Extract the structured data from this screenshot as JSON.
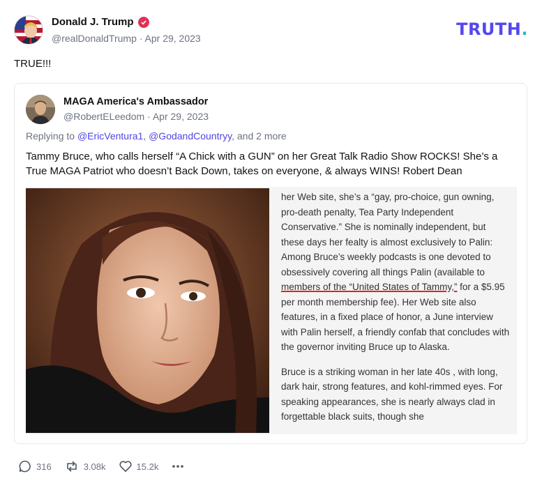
{
  "post": {
    "author_name": "Donald J. Trump",
    "handle": "@realDonaldTrump",
    "date": "Apr 29, 2023",
    "text": "TRUE!!!",
    "verified_icon": "verified-badge-icon",
    "avatar_icon": "avatar"
  },
  "brand": {
    "logo_text": "TRUTH",
    "logo_dot": ".",
    "accent": "#5448ee",
    "dot_color": "#12c6b4"
  },
  "quote": {
    "author_name": "MAGA America's Ambassador",
    "handle": "@RobertELeedom",
    "date": "Apr 29, 2023",
    "replying_prefix": "Replying to",
    "mention_1": "@EricVentura1",
    "mention_2": "@GodandCountryy",
    "replying_suffix": ", and 2 more",
    "mention_color": "#4f46e5",
    "body": "Tammy Bruce, who calls herself “A Chick with a GUN” on her Great Talk Radio Show ROCKS! She’s a True MAGA Patriot who doesn’t Back Down, takes on everyone, & always WINS! Robert Dean",
    "article": {
      "p1_a": "her Web site, she’s a “gay, pro-choice, gun owning, pro-death penalty, Tea Party Independent Conservative.” She is nominally independent, but these days her fealty is almost exclusively to Palin: Among Bruce’s weekly podcasts is one devoted to obsessively covering all things Palin (available to ",
      "p1_underlined": "members of the “United States of Tammy,”",
      "p1_b": " for a $5.95 per month membership fee). Her Web site also features, in a fixed place of honor, a June interview with Palin herself, a friendly confab that concludes with the governor inviting Bruce up to Alaska.",
      "p2": "Bruce is a striking woman in her late 40s , with long, dark hair, strong features, and kohl-rimmed eyes. For speaking appearances, she is nearly always clad in forgettable black suits, though she"
    }
  },
  "actions": {
    "replies": "316",
    "retruths": "3.08k",
    "likes": "15.2k",
    "reply_icon": "reply-icon",
    "retruth_icon": "retruth-icon",
    "like_icon": "heart-icon",
    "more_icon": "more-icon"
  }
}
